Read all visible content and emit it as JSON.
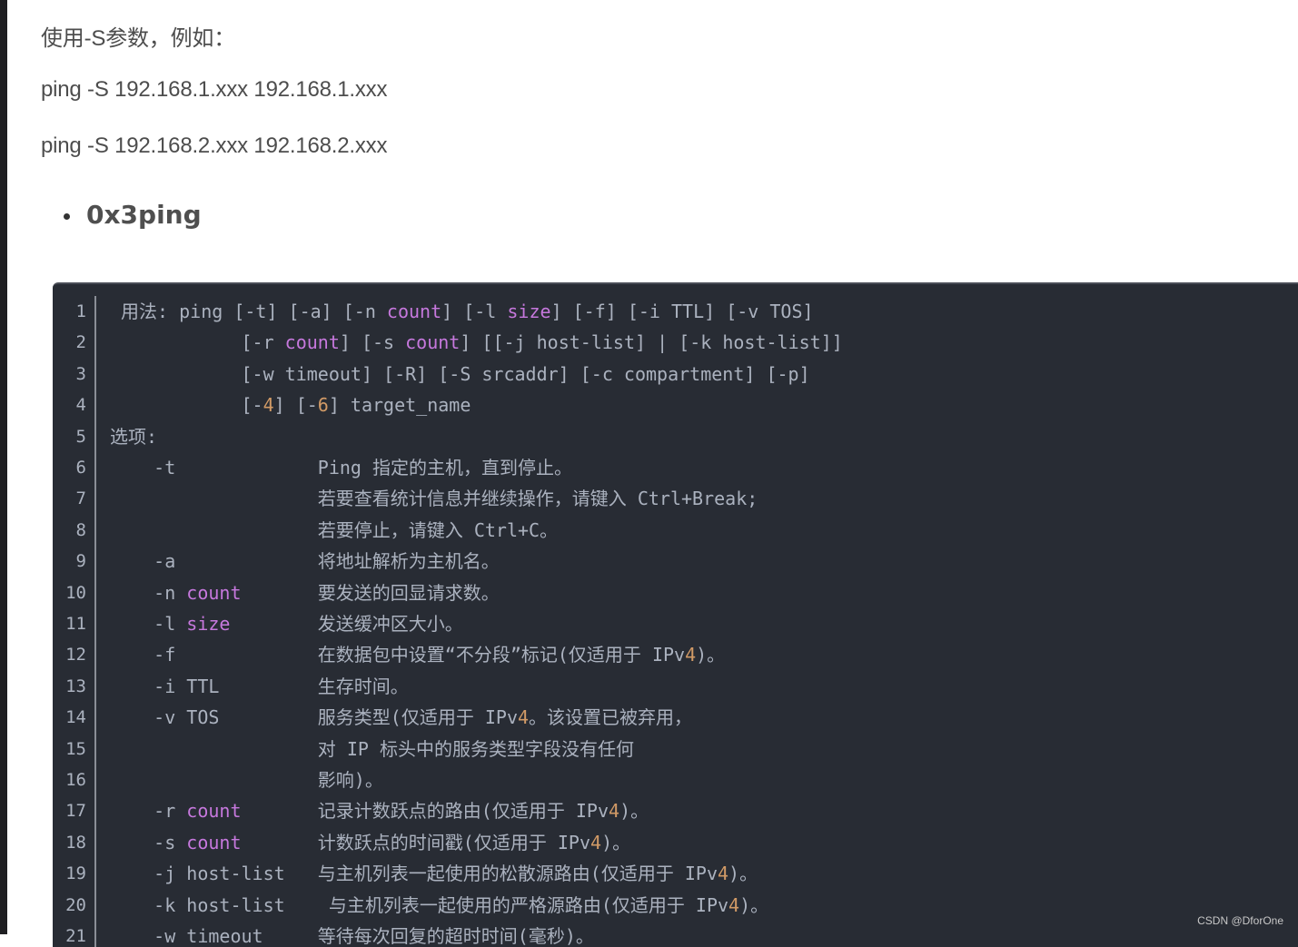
{
  "paragraphs": [
    "使用-S参数，例如：",
    "ping -S 192.168.1.xxx 192.168.1.xxx",
    "ping -S 192.168.2.xxx 192.168.2.xxx"
  ],
  "section_heading": "0x3ping",
  "code": {
    "language": "text",
    "lines": [
      {
        "n": "1",
        "segments": [
          {
            "t": "用法: ping [-t] [-a] [-n "
          },
          {
            "t": "count",
            "c": "kw"
          },
          {
            "t": "] [-l "
          },
          {
            "t": "size",
            "c": "kw"
          },
          {
            "t": "] [-f] [-i TTL] [-v TOS]"
          }
        ],
        "lead": " "
      },
      {
        "n": "2",
        "segments": [
          {
            "t": "            [-r "
          },
          {
            "t": "count",
            "c": "kw"
          },
          {
            "t": "] [-s "
          },
          {
            "t": "count",
            "c": "kw"
          },
          {
            "t": "] [[-j host-list] | [-k host-list]]"
          }
        ]
      },
      {
        "n": "3",
        "segments": [
          {
            "t": "            [-w timeout] [-R] [-S srcaddr] [-c compartment] [-p]"
          }
        ]
      },
      {
        "n": "4",
        "segments": [
          {
            "t": "            [-"
          },
          {
            "t": "4",
            "c": "num"
          },
          {
            "t": "] [-"
          },
          {
            "t": "6",
            "c": "num"
          },
          {
            "t": "] target_name"
          }
        ]
      },
      {
        "n": "5",
        "segments": [
          {
            "t": "选项:"
          }
        ]
      },
      {
        "n": "6",
        "segments": [
          {
            "t": "    -t             Ping 指定的主机，直到停止。"
          }
        ]
      },
      {
        "n": "7",
        "segments": [
          {
            "t": "                   若要查看统计信息并继续操作，请键入 Ctrl+Break;"
          }
        ]
      },
      {
        "n": "8",
        "segments": [
          {
            "t": "                   若要停止，请键入 Ctrl+C。"
          }
        ]
      },
      {
        "n": "9",
        "segments": [
          {
            "t": "    -a             将地址解析为主机名。"
          }
        ]
      },
      {
        "n": "10",
        "segments": [
          {
            "t": "    -n "
          },
          {
            "t": "count",
            "c": "kw"
          },
          {
            "t": "       要发送的回显请求数。"
          }
        ]
      },
      {
        "n": "11",
        "segments": [
          {
            "t": "    -l "
          },
          {
            "t": "size",
            "c": "kw"
          },
          {
            "t": "        发送缓冲区大小。"
          }
        ]
      },
      {
        "n": "12",
        "segments": [
          {
            "t": "    -f             在数据包中设置“不分段”标记(仅适用于 IPv"
          },
          {
            "t": "4",
            "c": "num"
          },
          {
            "t": ")。"
          }
        ]
      },
      {
        "n": "13",
        "segments": [
          {
            "t": "    -i TTL         生存时间。"
          }
        ]
      },
      {
        "n": "14",
        "segments": [
          {
            "t": "    -v TOS         服务类型(仅适用于 IPv"
          },
          {
            "t": "4",
            "c": "num"
          },
          {
            "t": "。该设置已被弃用，"
          }
        ]
      },
      {
        "n": "15",
        "segments": [
          {
            "t": "                   对 IP 标头中的服务类型字段没有任何"
          }
        ]
      },
      {
        "n": "16",
        "segments": [
          {
            "t": "                   影响)。"
          }
        ]
      },
      {
        "n": "17",
        "segments": [
          {
            "t": "    -r "
          },
          {
            "t": "count",
            "c": "kw"
          },
          {
            "t": "       记录计数跃点的路由(仅适用于 IPv"
          },
          {
            "t": "4",
            "c": "num"
          },
          {
            "t": ")。"
          }
        ]
      },
      {
        "n": "18",
        "segments": [
          {
            "t": "    -s "
          },
          {
            "t": "count",
            "c": "kw"
          },
          {
            "t": "       计数跃点的时间戳(仅适用于 IPv"
          },
          {
            "t": "4",
            "c": "num"
          },
          {
            "t": ")。"
          }
        ]
      },
      {
        "n": "19",
        "segments": [
          {
            "t": "    -j host-list   与主机列表一起使用的松散源路由(仅适用于 IPv"
          },
          {
            "t": "4",
            "c": "num"
          },
          {
            "t": ")。"
          }
        ]
      },
      {
        "n": "20",
        "segments": [
          {
            "t": "    -k host-list    与主机列表一起使用的严格源路由(仅适用于 IPv"
          },
          {
            "t": "4",
            "c": "num"
          },
          {
            "t": ")。"
          }
        ]
      },
      {
        "n": "21",
        "segments": [
          {
            "t": "    -w timeout     等待每次回复的超时时间(毫秒)。"
          }
        ]
      }
    ]
  },
  "watermark": "CSDN @DforOne"
}
